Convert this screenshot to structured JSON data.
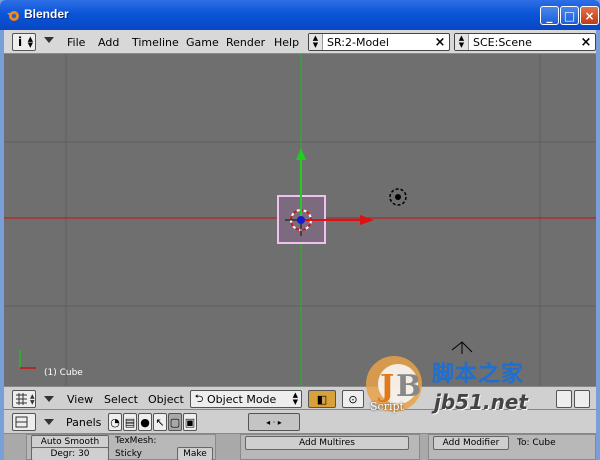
{
  "window": {
    "title": "Blender",
    "minimize": "_",
    "maximize": "□",
    "close": "×"
  },
  "top_header": {
    "info_icon": "i",
    "menus": [
      "File",
      "Add",
      "Timeline",
      "Game",
      "Render",
      "Help"
    ],
    "screen_field": "SR:2-Model",
    "scene_field": "SCE:Scene",
    "clear": "×"
  },
  "viewport": {
    "object_label": "(1) Cube",
    "axis_colors": {
      "x": "#cc1111",
      "y": "#22bb22"
    }
  },
  "view_header": {
    "view": "View",
    "select": "Select",
    "object": "Object",
    "mode": "Object Mode"
  },
  "buttons_window": {
    "panels_label": "Panels",
    "auto_smooth": "Auto Smooth",
    "degr": "Degr: 30",
    "texmesh": "TexMesh:",
    "sticky": "Sticky",
    "make": "Make",
    "add_multires": "Add Multires",
    "add_modifier": "Add Modifier",
    "to_cube": "To: Cube"
  },
  "watermark": {
    "site": "脚本之家",
    "url": "jb51.net",
    "script": "Script"
  }
}
